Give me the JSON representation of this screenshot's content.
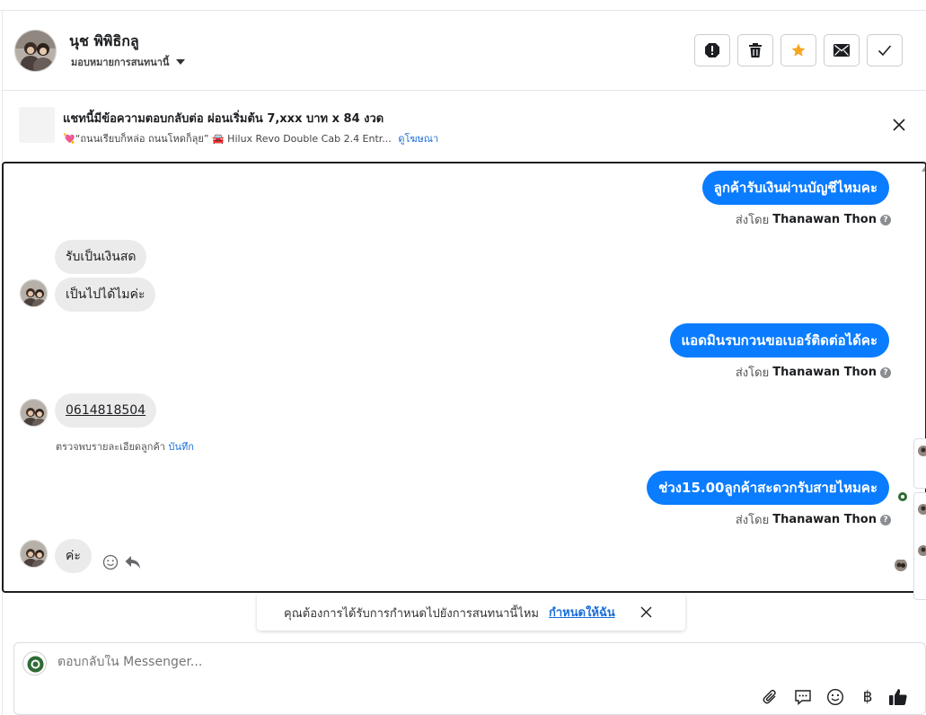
{
  "header": {
    "contact_name": "นุช พิพิธิกลู",
    "assign_label": "มอบหมายการสนทนานี้",
    "actions": [
      {
        "name": "spam",
        "icon": "alert-icon"
      },
      {
        "name": "delete",
        "icon": "trash-icon"
      },
      {
        "name": "star",
        "icon": "star-icon"
      },
      {
        "name": "mark-unread",
        "icon": "envelope-icon"
      },
      {
        "name": "mark-done",
        "icon": "check-icon"
      }
    ]
  },
  "ad": {
    "title": "แชทนี้มีข้อความตอบกลับต่อ ผ่อนเริ่มต้น 7,xxx บาท x 84 งวด",
    "subtitle": "💘“ถนนเรียบก็หล่อ ถนนโหดก็ลุย” 🚘 Hilux Revo Double Cab 2.4 Entr...",
    "link": "ดูโฆษณา"
  },
  "messages": [
    {
      "dir": "out",
      "text": "ลูกค้ารับเงินผ่านบัญชีไหมคะ"
    },
    {
      "dir": "meta",
      "sent_by_label": "ส่งโดย",
      "sender": "Thanawan Thon"
    },
    {
      "dir": "in",
      "text": "รับเป็นเงินสด"
    },
    {
      "dir": "in",
      "text": "เป็นไปได้ไมค่ะ"
    },
    {
      "dir": "out",
      "text": "แอดมินรบกวนขอเบอร์ติดต่อได้คะ"
    },
    {
      "dir": "meta",
      "sent_by_label": "ส่งโดย",
      "sender": "Thanawan Thon"
    },
    {
      "dir": "in",
      "text": "0614818504"
    },
    {
      "dir": "detail",
      "text": "ตรวจพบรายละเอียดลูกค้า",
      "link": "บันทึก"
    },
    {
      "dir": "out",
      "text": "ช่วง15.00ลูกค้าสะดวกรับสายไหมคะ"
    },
    {
      "dir": "meta",
      "sent_by_label": "ส่งโดย",
      "sender": "Thanawan Thon"
    },
    {
      "dir": "in",
      "text": "ค่ะ"
    }
  ],
  "assign_banner": {
    "text": "คุณต้องการได้รับการกำหนดไปยังการสนทนานี้ไหม",
    "link": "กำหนดให้ฉัน"
  },
  "composer": {
    "placeholder": "ตอบกลับใน Messenger...",
    "tools": [
      "paperclip-icon",
      "speech-bubble-icon",
      "emoji-icon",
      "baht-icon",
      "thumbs-up-icon"
    ],
    "baht_symbol": "฿"
  },
  "colors": {
    "outgoing_bubble": "#0a7cff",
    "incoming_bubble": "#ebebeb",
    "link": "#1a6ed8",
    "star": "#f5a623"
  }
}
